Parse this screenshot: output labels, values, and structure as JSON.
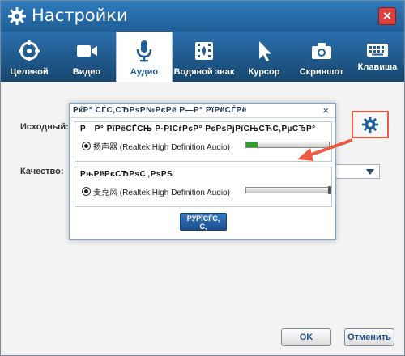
{
  "window": {
    "title": "Настройки"
  },
  "tabs": [
    {
      "label": "Целевой",
      "icon": "target-icon",
      "active": false
    },
    {
      "label": "Видео",
      "icon": "video-camera-icon",
      "active": false
    },
    {
      "label": "Аудио",
      "icon": "microphone-icon",
      "active": true
    },
    {
      "label": "Водяной знак",
      "icon": "watermark-film-icon",
      "active": false
    },
    {
      "label": "Курсор",
      "icon": "cursor-icon",
      "active": false
    },
    {
      "label": "Скриншот",
      "icon": "camera-icon",
      "active": false
    },
    {
      "label": "Клавиша",
      "icon": "keyboard-icon",
      "active": false
    }
  ],
  "audio": {
    "source_label": "Исходный:",
    "quality_label": "Качество:"
  },
  "dialog": {
    "title": "РќР° СЃС‚СЂРѕР№РєРё  Р—Р° РїРёСЃРё",
    "group1_title": "Р—Р° РїРёСЃСЊ  Р·РІСѓРєР°  РєРѕРјРїСЊСЋС‚РµСЂР°",
    "device1": "扬声器 (Realtek High Definition Audio)",
    "device1_level": 0.14,
    "group2_title": "РњРёРєСЂРѕС„РѕРЅ",
    "device2": "麦克风 (Realtek High Definition Audio)",
    "device2_level": 1.0,
    "button_line1": "РУРїСЃС‚",
    "button_line2": "С‚",
    "close": "×"
  },
  "footer": {
    "ok_label": "OK",
    "cancel_label": "Отменить"
  },
  "colors": {
    "titlebar": "#2f7bbd",
    "tabbar": "#1f5e96",
    "annotation": "#ec5a42",
    "meter_fill": "#2e9e2e"
  }
}
